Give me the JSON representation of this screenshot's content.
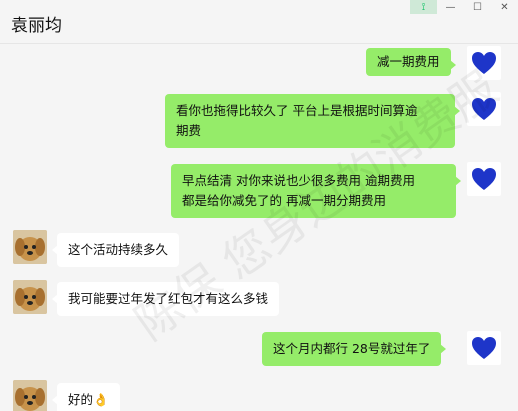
{
  "window": {
    "title": "袁丽均",
    "controls": [
      {
        "name": "pin",
        "glyph": "⟟"
      },
      {
        "name": "minimize",
        "glyph": "—"
      },
      {
        "name": "maximize",
        "glyph": "☐"
      },
      {
        "name": "close",
        "glyph": "✕"
      }
    ]
  },
  "messages": [
    {
      "side": "me",
      "lines": [
        "减一期费用"
      ]
    },
    {
      "side": "me",
      "lines": [
        "看你也拖得比较久了 平台上是根据时间算逾",
        "期费"
      ]
    },
    {
      "side": "me",
      "lines": [
        "早点结清 对你来说也少很多费用  逾期费用",
        "都是给你减免了的 再减一期分期费用"
      ]
    },
    {
      "side": "other",
      "lines": [
        "这个活动持续多久"
      ]
    },
    {
      "side": "other",
      "lines": [
        "我可能要过年发了红包才有这么多钱"
      ]
    },
    {
      "side": "me",
      "lines": [
        "这个月内都行 28号就过年了"
      ]
    },
    {
      "side": "other",
      "lines": [
        "好的👌"
      ]
    }
  ],
  "watermark": {
    "text": "陈保 您身边的消费服"
  },
  "colors": {
    "bubble_me": "#95ec69",
    "bubble_other": "#ffffff",
    "heart": "#1e35c9"
  },
  "avatars": {
    "me": "blue-heart-icon",
    "other": "dog-photo"
  }
}
